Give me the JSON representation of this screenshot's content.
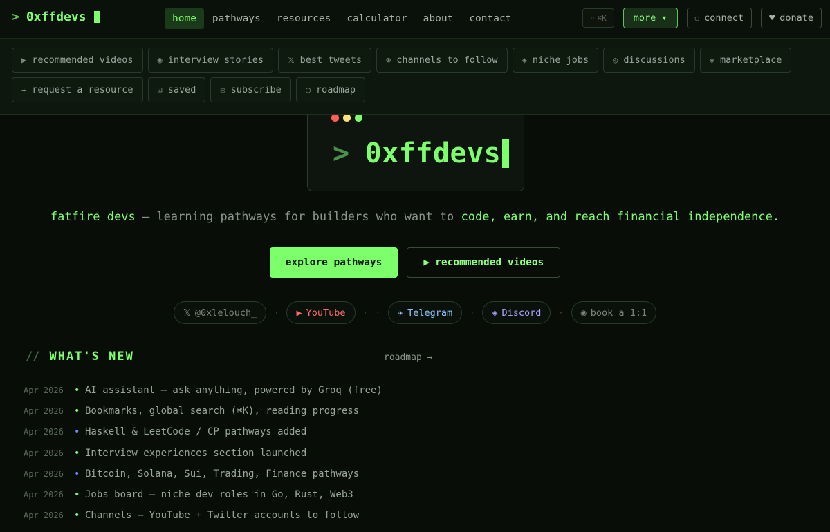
{
  "brand": {
    "prompt": ">",
    "name": "0xffdevs"
  },
  "nav": [
    {
      "label": "home",
      "active": true
    },
    {
      "label": "pathways",
      "active": false
    },
    {
      "label": "resources",
      "active": false
    },
    {
      "label": "calculator",
      "active": false
    },
    {
      "label": "about",
      "active": false
    },
    {
      "label": "contact",
      "active": false
    }
  ],
  "actions": {
    "search_icon": "⌕",
    "search_shortcut": "⌘K",
    "more_label": "more ▾",
    "connect_icon": "○",
    "connect_label": "connect",
    "donate_icon": "♥",
    "donate_label": "donate"
  },
  "menu": [
    {
      "icon": "▶",
      "label": "recommended videos"
    },
    {
      "icon": "◉",
      "label": "interview stories"
    },
    {
      "icon": "𝕏",
      "label": "best tweets"
    },
    {
      "icon": "⊕",
      "label": "channels to follow"
    },
    {
      "icon": "◈",
      "label": "niche jobs"
    },
    {
      "icon": "◎",
      "label": "discussions"
    },
    {
      "icon": "◈",
      "label": "marketplace"
    },
    {
      "icon": "+",
      "label": "request a resource"
    },
    {
      "icon": "⊡",
      "label": "saved"
    },
    {
      "icon": "✉",
      "label": "subscribe"
    },
    {
      "icon": "○",
      "label": "roadmap"
    }
  ],
  "hero": {
    "prompt": ">",
    "title": "0xffdevs",
    "tagline_start": "fatfire devs",
    "tagline_mid": " — learning pathways for builders who want to ",
    "tagline_end": "code, earn, and reach financial independence."
  },
  "cta": {
    "primary": "explore pathways",
    "secondary_icon": "▶",
    "secondary": "recommended videos"
  },
  "socials": [
    {
      "icon": "𝕏",
      "label": "@0xlelouch_",
      "color": "#7a857a"
    },
    {
      "icon": "▶",
      "label": "YouTube",
      "color": "#ff6b6b"
    },
    {
      "icon": "✈",
      "label": "Telegram",
      "color": "#8ac4ff"
    },
    {
      "icon": "◈",
      "label": "Discord",
      "color": "#a9a6ff"
    },
    {
      "icon": "◉",
      "label": "book a 1:1",
      "color": "#7a857a"
    }
  ],
  "separator": "·",
  "whats_new": {
    "slashes": "//",
    "title": "WHAT'S NEW",
    "roadmap_link": "roadmap →",
    "items": [
      {
        "date": "Apr 2026",
        "text": "AI assistant — ask anything, powered by Groq (free)",
        "dot_color": "#7dff6b"
      },
      {
        "date": "Apr 2026",
        "text": "Bookmarks, global search (⌘K), reading progress",
        "dot_color": "#7dff6b"
      },
      {
        "date": "Apr 2026",
        "text": "Haskell & LeetCode / CP pathways added",
        "dot_color": "#6b8cff"
      },
      {
        "date": "Apr 2026",
        "text": "Interview experiences section launched",
        "dot_color": "#7dff6b"
      },
      {
        "date": "Apr 2026",
        "text": "Bitcoin, Solana, Sui, Trading, Finance pathways",
        "dot_color": "#6b8cff"
      },
      {
        "date": "Apr 2026",
        "text": "Jobs board — niche dev roles in Go, Rust, Web3",
        "dot_color": "#7dff6b"
      },
      {
        "date": "Apr 2026",
        "text": "Channels — YouTube + Twitter accounts to follow",
        "dot_color": "#7dff6b"
      }
    ]
  },
  "colors": {
    "accent": "#7dff6b",
    "background": "#080d08",
    "dot_red": "#ff5f57",
    "dot_yellow": "#ffe27a",
    "dot_green": "#7dff6b"
  }
}
